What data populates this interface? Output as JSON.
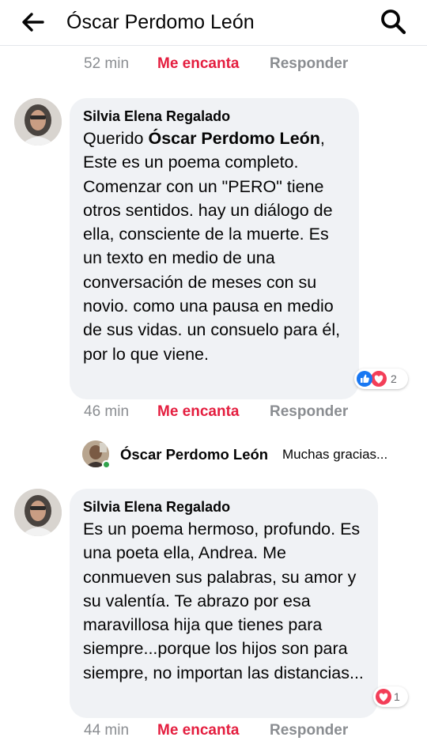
{
  "header": {
    "title": "Óscar Perdomo León",
    "back_icon": "arrow-left-icon",
    "search_icon": "search-icon"
  },
  "actions": {
    "love_label": "Me encanta",
    "reply_label": "Responder"
  },
  "top_row": {
    "time": "52 min"
  },
  "comments": [
    {
      "author": "Silvia Elena Regalado",
      "text_before": "Querido ",
      "mention": "Óscar Perdomo León",
      "text_after": ", Este es un poema completo. Comenzar con un \"PERO\" tiene otros sentidos. hay un diálogo de ella, consciente de la muerte. Es un texto en medio de una conversación de meses con su novio. como una pausa en medio de sus vidas. un consuelo para él, por lo que viene.",
      "reactions": {
        "icons": [
          "like-icon",
          "love-icon"
        ],
        "count": "2"
      },
      "time": "46 min"
    },
    {
      "author": "Silvia Elena Regalado",
      "text": "Es un poema hermoso, profundo. Es una poeta ella, Andrea. Me conmueven sus palabras, su amor y su valentía. Te abrazo por esa maravillosa hija que tienes para siempre...porque los hijos son para siempre, no importan las distancias...",
      "reactions": {
        "icons": [
          "love-icon"
        ],
        "count": "1"
      },
      "time": "44 min"
    }
  ],
  "reply_preview": {
    "author": "Óscar Perdomo León",
    "snippet": "Muchas gracias..."
  },
  "colors": {
    "accent_love": "#e41e3f",
    "like_blue": "#1877f2",
    "muted": "#8a8d91",
    "bubble_bg": "#f0f2f5",
    "online": "#31a24c"
  }
}
